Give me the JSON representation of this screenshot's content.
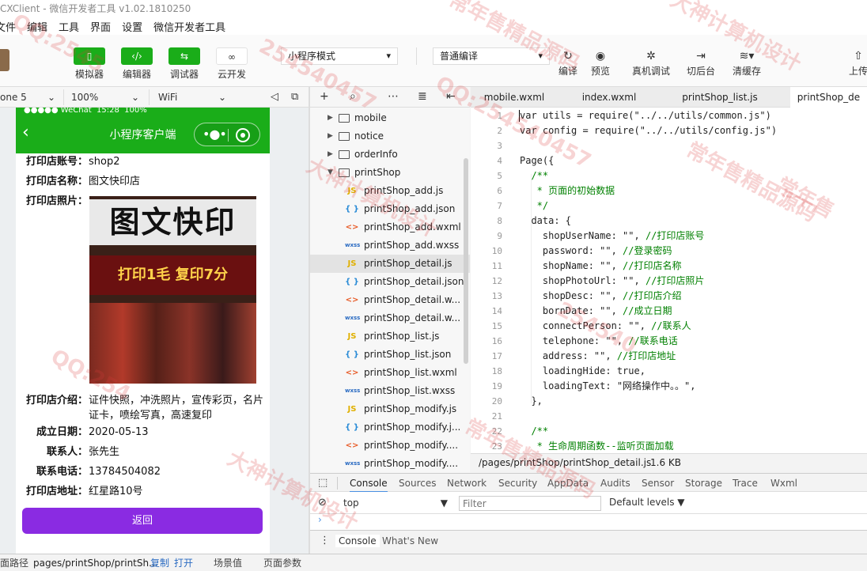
{
  "window": {
    "title": "CXClient - 微信开发者工具 v1.02.1810250"
  },
  "menu": [
    "文件",
    "编辑",
    "工具",
    "界面",
    "设置",
    "微信开发者工具"
  ],
  "toolbar": {
    "simulator": "模拟器",
    "editor": "编辑器",
    "debugger": "调试器",
    "cloud": "云开发",
    "mode": "小程序模式",
    "compile_mode": "普通编译",
    "compile": "编译",
    "preview": "预览",
    "remote_debug": "真机调试",
    "background": "切后台",
    "clear_cache": "清缓存",
    "upload": "上传"
  },
  "simulator_bar": {
    "device": "one 5",
    "zoom": "100%",
    "network": "WiFi"
  },
  "phone": {
    "status": "●●●●● WeChat  15:28  100%",
    "nav_title": "小程序客户端",
    "fields": [
      {
        "label": "打印店账号：",
        "value": "shop2"
      },
      {
        "label": "打印店名称：",
        "value": "图文快印店"
      },
      {
        "label": "打印店照片：",
        "value": ""
      },
      {
        "label": "打印店介绍：",
        "value": "证件快照，冲洗照片，宣传彩页，名片证卡，喷绘写真，高速复印"
      },
      {
        "label": "成立日期：",
        "value": "2020-05-13"
      },
      {
        "label": "联系人：",
        "value": "张先生"
      },
      {
        "label": "联系电话：",
        "value": "13784504082"
      },
      {
        "label": "打印店地址：",
        "value": "红星路10号"
      }
    ],
    "photo_sign": "图文快印",
    "photo_banner": "打印1毛 复印7分",
    "back_button": "返回"
  },
  "file_tree": [
    {
      "type": "folder",
      "name": "mobile",
      "open": false
    },
    {
      "type": "folder",
      "name": "notice",
      "open": false
    },
    {
      "type": "folder",
      "name": "orderInfo",
      "open": false
    },
    {
      "type": "folder",
      "name": "printShop",
      "open": true
    },
    {
      "type": "js",
      "name": "printShop_add.js"
    },
    {
      "type": "json",
      "name": "printShop_add.json"
    },
    {
      "type": "wxml",
      "name": "printShop_add.wxml"
    },
    {
      "type": "wxss",
      "name": "printShop_add.wxss"
    },
    {
      "type": "js",
      "name": "printShop_detail.js",
      "selected": true
    },
    {
      "type": "json",
      "name": "printShop_detail.json"
    },
    {
      "type": "wxml",
      "name": "printShop_detail.w..."
    },
    {
      "type": "wxss",
      "name": "printShop_detail.w..."
    },
    {
      "type": "js",
      "name": "printShop_list.js"
    },
    {
      "type": "json",
      "name": "printShop_list.json"
    },
    {
      "type": "wxml",
      "name": "printShop_list.wxml"
    },
    {
      "type": "wxss",
      "name": "printShop_list.wxss"
    },
    {
      "type": "js",
      "name": "printShop_modify.js"
    },
    {
      "type": "json",
      "name": "printShop_modify.j..."
    },
    {
      "type": "wxml",
      "name": "printShop_modify...."
    },
    {
      "type": "wxss",
      "name": "printShop_modify...."
    }
  ],
  "tabs": [
    "mobile.wxml",
    "index.wxml",
    "printShop_list.js",
    "printShop_de"
  ],
  "code": [
    "var utils = require(\"../../utils/common.js\")",
    "var config = require(\"../../utils/config.js\")",
    "",
    "Page({",
    "  /**",
    "   * 页面的初始数据",
    "   */",
    "  data: {",
    "    shopUserName: \"\", //打印店账号",
    "    password: \"\", //登录密码",
    "    shopName: \"\", //打印店名称",
    "    shopPhotoUrl: \"\", //打印店照片",
    "    shopDesc: \"\", //打印店介绍",
    "    bornDate: \"\", //成立日期",
    "    connectPerson: \"\", //联系人",
    "    telephone: \"\", //联系电话",
    "    address: \"\", //打印店地址",
    "    loadingHide: true,",
    "    loadingText: \"网络操作中。。\",",
    "  },",
    "",
    "  /**",
    "   * 生命周期函数--监听页面加载"
  ],
  "editor_status": {
    "path": "/pages/printShop/printShop_detail.js",
    "size": "1.6 KB"
  },
  "devtools": {
    "tabs": [
      "Console",
      "Sources",
      "Network",
      "Security",
      "AppData",
      "Audits",
      "Sensor",
      "Storage",
      "Trace",
      "Wxml"
    ],
    "context": "top",
    "filter_placeholder": "Filter",
    "levels": "Default levels",
    "drawer_tabs": [
      "Console",
      "What's New"
    ]
  },
  "bottom": {
    "path_label": "面路径",
    "path": "pages/printShop/printSh...",
    "copy": "复制",
    "open": "打开",
    "scene": "场景值",
    "params": "页面参数"
  },
  "watermarks": [
    "QQ:2545",
    "254540457",
    "常年售精品源码",
    "大神计算机设计",
    "常年售",
    "QQ:254540457",
    "常年售精品源码",
    "大神计算机设计",
    "QQ:254",
    "254540",
    "常年售精品源码",
    "大神计算机设计"
  ]
}
